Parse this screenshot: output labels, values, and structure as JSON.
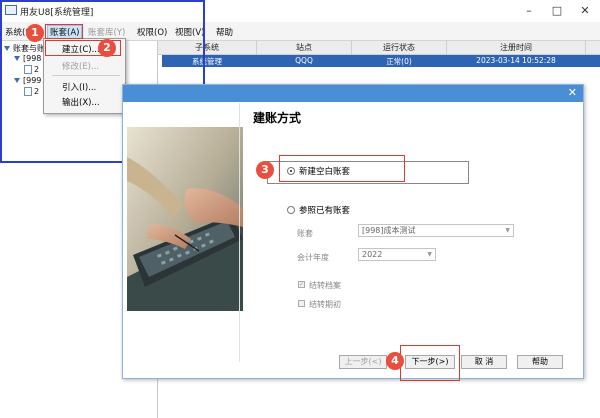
{
  "window": {
    "title": "用友U8[系统管理]",
    "controls": {
      "minimize": "–",
      "maximize": "□",
      "close": "✕"
    }
  },
  "menubar": [
    {
      "label": "系统(S)"
    },
    {
      "label": "账套(A)"
    },
    {
      "label": "账套库(Y)"
    },
    {
      "label": "权限(O)"
    },
    {
      "label": "视图(V)"
    },
    {
      "label": "帮助"
    }
  ],
  "dropdown": {
    "items": [
      {
        "label": "建立(C)..."
      },
      {
        "label": "修改(E)..."
      },
      {
        "label": "引入(I)..."
      },
      {
        "label": "输出(X)..."
      }
    ]
  },
  "tree": {
    "root": "账套与账",
    "items": [
      {
        "label": "[998"
      },
      {
        "label": "2"
      },
      {
        "label": "[999"
      },
      {
        "label": "2"
      }
    ]
  },
  "list": {
    "columns": [
      "子系统",
      "站点",
      "运行状态",
      "注册时间"
    ],
    "rows": [
      {
        "subsystem": "系统管理",
        "site": "QQQ",
        "status": "正常(0)",
        "time": "2023-03-14 10:52:28"
      }
    ]
  },
  "dialog": {
    "heading": "建账方式",
    "close": "✕",
    "option_new": "新建空白账套",
    "option_ref": "参照已有账套",
    "account_label": "账套",
    "account_value": "[998]成本测试",
    "year_label": "会计年度",
    "year_value": "2022",
    "chk_archive": "结转档案",
    "chk_period": "结转期初",
    "buttons": {
      "prev": "上一步(<)",
      "next": "下一步(>)",
      "cancel": "取 消",
      "help": "帮助"
    }
  },
  "annotations": {
    "b1": "1",
    "b2": "2",
    "b3": "3",
    "b4": "4"
  },
  "colors": {
    "accent": "#2f63b4",
    "annotation": "#e94f3e",
    "frame": "#2b3fcf"
  }
}
